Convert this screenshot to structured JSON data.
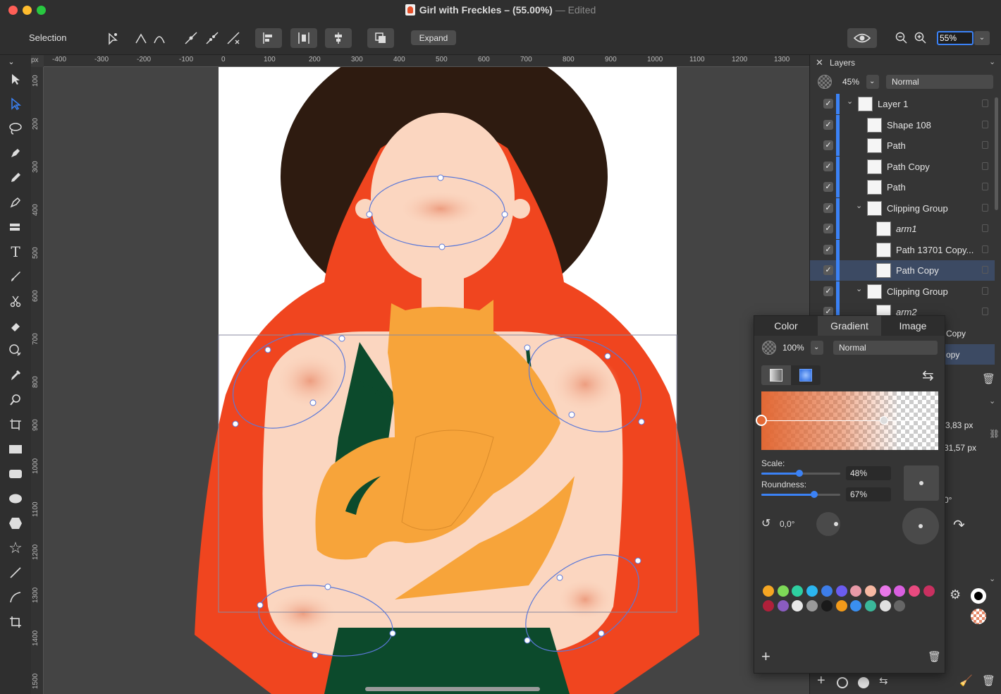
{
  "window": {
    "title": "Girl with Freckles – (55.00%)",
    "edited": "— Edited"
  },
  "toolbar": {
    "mode_label": "Selection",
    "expand_label": "Expand",
    "zoom_value": "55%"
  },
  "ruler": {
    "unit": "px",
    "top_ticks": [
      "-400",
      "-300",
      "-200",
      "-100",
      "0",
      "100",
      "200",
      "300",
      "400",
      "500",
      "600",
      "700",
      "800",
      "900",
      "1000",
      "1100",
      "1200",
      "1300"
    ],
    "left_ticks": [
      "100",
      "200",
      "300",
      "400",
      "500",
      "600",
      "700",
      "800",
      "900",
      "1000",
      "1100",
      "1200",
      "1300",
      "1400",
      "1500"
    ]
  },
  "layers_panel": {
    "title": "Layers",
    "opacity": "45%",
    "blend_mode": "Normal",
    "layers": [
      {
        "name": "Layer 1",
        "level": 0,
        "group": true,
        "selected": false
      },
      {
        "name": "Shape 108",
        "level": 1,
        "group": false,
        "selected": false
      },
      {
        "name": "Path",
        "level": 1,
        "group": false,
        "selected": false
      },
      {
        "name": "Path Copy",
        "level": 1,
        "group": false,
        "selected": false
      },
      {
        "name": "Path",
        "level": 1,
        "group": false,
        "selected": false
      },
      {
        "name": "Clipping Group",
        "level": 1,
        "group": true,
        "selected": false
      },
      {
        "name": "arm1",
        "level": 2,
        "group": false,
        "selected": false
      },
      {
        "name": "Path 13701 Copy...",
        "level": 2,
        "group": false,
        "selected": false
      },
      {
        "name": "Path Copy",
        "level": 2,
        "group": false,
        "selected": true
      },
      {
        "name": "Clipping Group",
        "level": 1,
        "group": true,
        "selected": false
      },
      {
        "name": "arm2",
        "level": 2,
        "group": false,
        "selected": false
      }
    ],
    "peek_texts": [
      "Copy",
      "opy"
    ],
    "peek_values": [
      "3,83 px",
      "31,57 px",
      "0°"
    ]
  },
  "gradient_panel": {
    "tabs": [
      "Color",
      "Gradient",
      "Image"
    ],
    "active_tab": "Gradient",
    "opacity": "100%",
    "blend_mode": "Normal",
    "scale_label": "Scale:",
    "scale_value": "48%",
    "scale_fraction": 0.48,
    "roundness_label": "Roundness:",
    "roundness_value": "67%",
    "roundness_fraction": 0.67,
    "angle_value": "0,0°",
    "swatches_row1": [
      "#f5a623",
      "#7ed957",
      "#2ecfa0",
      "#2bb6f0",
      "#3d7de8",
      "#6b5cf0",
      "#e89aa8",
      "#f7b8a2",
      "#e877e8",
      "#d95fe0",
      "#e84a7f",
      "#c93060"
    ],
    "swatches_row2": [
      "#b0203a",
      "#8a5cc0",
      "#e8e8e8",
      "#9a9a9a",
      "#1a1a1a",
      "#f29a1a",
      "#3a8ff0",
      "#3ab89a",
      "#e0e0e0",
      "#666666"
    ]
  },
  "colors": {
    "accent": "#3b82f6",
    "hair": "#f0451f",
    "skin": "#fbd6c0",
    "cat": "#f7a43a",
    "halo": "#2e1b10",
    "dress": "#0c4a2c"
  }
}
